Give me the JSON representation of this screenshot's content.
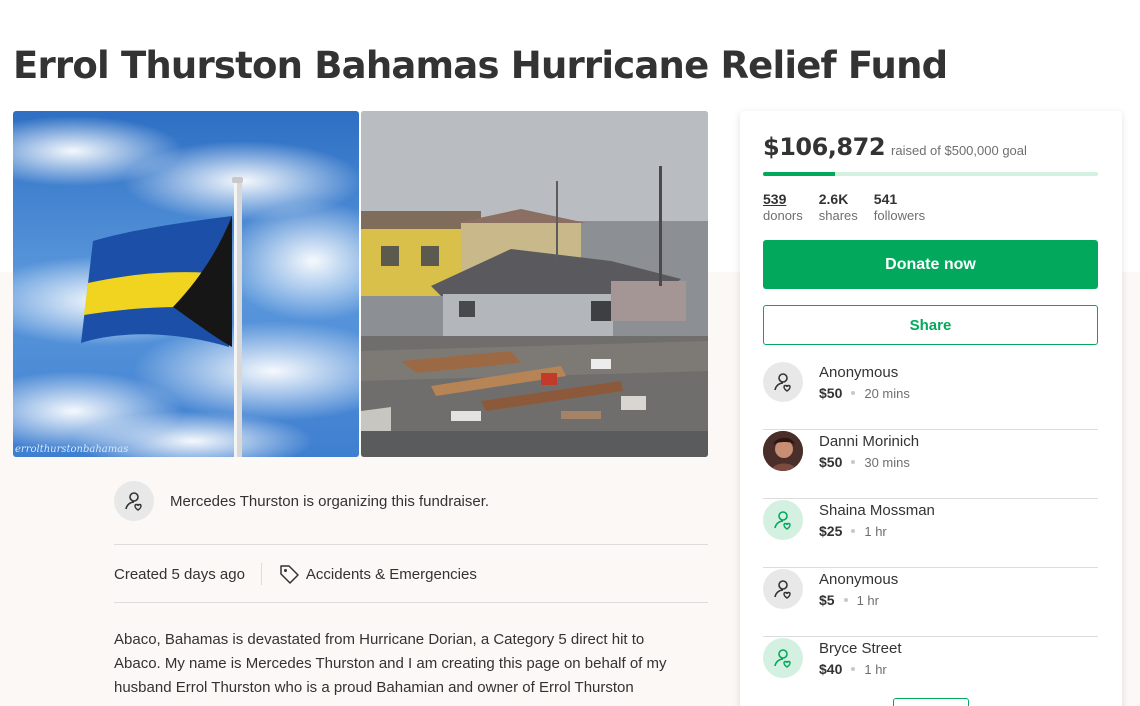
{
  "page": {
    "title": "Errol Thurston Bahamas Hurricane Relief Fund"
  },
  "photos": {
    "left_watermark": "errolthurstonbahamas"
  },
  "organizer": {
    "text": "Mercedes Thurston is organizing this fundraiser.",
    "icon": "person-heart-icon"
  },
  "meta": {
    "created": "Created 5 days ago",
    "category": "Accidents & Emergencies",
    "category_icon": "tag-icon"
  },
  "story": {
    "lines": [
      "Abaco, Bahamas is devastated from Hurricane Dorian, a Category 5 direct hit to",
      "Abaco.   My name is Mercedes Thurston and I am creating this page on behalf of my",
      "husband Errol Thurston who is a proud Bahamian and owner of Errol Thurston"
    ]
  },
  "campaign": {
    "raised": "$106,872",
    "goal_text": "raised of $500,000 goal",
    "progress_fraction": 0.214,
    "stats": {
      "donors_count": "539",
      "donors_label": "donors",
      "shares_count": "2.6K",
      "shares_label": "shares",
      "followers_count": "541",
      "followers_label": "followers"
    },
    "donate_label": "Donate now",
    "share_label": "Share",
    "colors": {
      "primary_green": "#02a95c",
      "light_green": "#d3f0e0"
    }
  },
  "donations": [
    {
      "name": "Anonymous",
      "amount": "$50",
      "time": "20 mins",
      "avatar": "gray"
    },
    {
      "name": "Danni Morinich",
      "amount": "$50",
      "time": "30 mins",
      "avatar": "photo"
    },
    {
      "name": "Shaina Mossman",
      "amount": "$25",
      "time": "1 hr",
      "avatar": "green"
    },
    {
      "name": "Anonymous",
      "amount": "$5",
      "time": "1 hr",
      "avatar": "gray"
    },
    {
      "name": "Bryce Street",
      "amount": "$40",
      "time": "1 hr",
      "avatar": "green"
    }
  ]
}
